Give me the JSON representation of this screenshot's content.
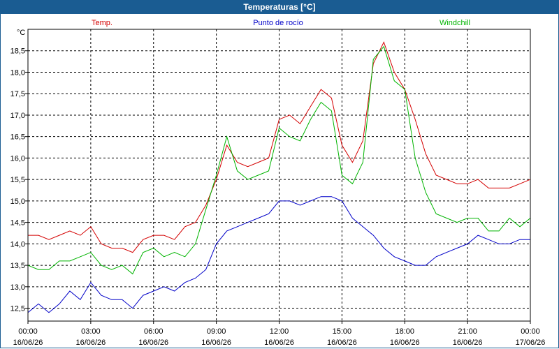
{
  "window": {
    "title": "Temperaturas [°C]"
  },
  "colors": {
    "titlebar": "#1a5c92"
  },
  "chart_data": {
    "type": "line",
    "ylabel": "°C",
    "ylim": [
      12.2,
      19.0
    ],
    "yticks": [
      "12,5",
      "13,0",
      "13,5",
      "14,0",
      "14,5",
      "15,0",
      "15,5",
      "16,0",
      "16,5",
      "17,0",
      "17,5",
      "18,0",
      "18,5"
    ],
    "ytick_values": [
      12.5,
      13.0,
      13.5,
      14.0,
      14.5,
      15.0,
      15.5,
      16.0,
      16.5,
      17.0,
      17.5,
      18.0,
      18.5
    ],
    "xticks": [
      {
        "time": "00:00",
        "date": "16/06/26"
      },
      {
        "time": "03:00",
        "date": "16/06/26"
      },
      {
        "time": "06:00",
        "date": "16/06/26"
      },
      {
        "time": "09:00",
        "date": "16/06/26"
      },
      {
        "time": "12:00",
        "date": "16/06/26"
      },
      {
        "time": "15:00",
        "date": "16/06/26"
      },
      {
        "time": "18:00",
        "date": "16/06/26"
      },
      {
        "time": "21:00",
        "date": "16/06/26"
      },
      {
        "time": "00:00",
        "date": "17/06/26"
      }
    ],
    "xlim_hours": [
      0,
      24
    ],
    "grid": true,
    "series": [
      {
        "name": "Temp.",
        "color": "#d40000",
        "x": [
          0,
          0.5,
          1,
          1.5,
          2,
          2.5,
          3,
          3.5,
          4,
          4.5,
          5,
          5.5,
          6,
          6.5,
          7,
          7.5,
          8,
          8.5,
          9,
          9.5,
          10,
          10.5,
          11,
          11.5,
          12,
          12.5,
          13,
          13.5,
          14,
          14.5,
          15,
          15.5,
          16,
          16.5,
          17,
          17.5,
          18,
          18.5,
          19,
          19.5,
          20,
          20.5,
          21,
          21.5,
          22,
          22.5,
          23,
          23.5,
          24
        ],
        "y": [
          14.2,
          14.2,
          14.1,
          14.2,
          14.3,
          14.2,
          14.4,
          14.0,
          13.9,
          13.9,
          13.8,
          14.1,
          14.2,
          14.2,
          14.1,
          14.4,
          14.5,
          14.9,
          15.5,
          16.3,
          15.9,
          15.8,
          15.9,
          16.0,
          16.9,
          17.0,
          16.8,
          17.2,
          17.6,
          17.4,
          16.3,
          15.9,
          16.4,
          18.2,
          18.7,
          18.0,
          17.6,
          16.9,
          16.1,
          15.6,
          15.5,
          15.4,
          15.4,
          15.5,
          15.3,
          15.3,
          15.3,
          15.4,
          15.5
        ]
      },
      {
        "name": "Punto de rocío",
        "color": "#0000c8",
        "x": [
          0,
          0.5,
          1,
          1.5,
          2,
          2.5,
          3,
          3.5,
          4,
          4.5,
          5,
          5.5,
          6,
          6.5,
          7,
          7.5,
          8,
          8.5,
          9,
          9.5,
          10,
          10.5,
          11,
          11.5,
          12,
          12.5,
          13,
          13.5,
          14,
          14.5,
          15,
          15.5,
          16,
          16.5,
          17,
          17.5,
          18,
          18.5,
          19,
          19.5,
          20,
          20.5,
          21,
          21.5,
          22,
          22.5,
          23,
          23.5,
          24
        ],
        "y": [
          12.4,
          12.6,
          12.4,
          12.6,
          12.9,
          12.7,
          13.1,
          12.8,
          12.7,
          12.7,
          12.5,
          12.8,
          12.9,
          13.0,
          12.9,
          13.1,
          13.2,
          13.4,
          14.0,
          14.3,
          14.4,
          14.5,
          14.6,
          14.7,
          15.0,
          15.0,
          14.9,
          15.0,
          15.1,
          15.1,
          15.0,
          14.6,
          14.4,
          14.2,
          13.9,
          13.7,
          13.6,
          13.5,
          13.5,
          13.7,
          13.8,
          13.9,
          14.0,
          14.2,
          14.1,
          14.0,
          14.0,
          14.1,
          14.1
        ]
      },
      {
        "name": "Windchill",
        "color": "#00b400",
        "x": [
          0,
          0.5,
          1,
          1.5,
          2,
          2.5,
          3,
          3.5,
          4,
          4.5,
          5,
          5.5,
          6,
          6.5,
          7,
          7.5,
          8,
          8.5,
          9,
          9.5,
          10,
          10.5,
          11,
          11.5,
          12,
          12.5,
          13,
          13.5,
          14,
          14.5,
          15,
          15.5,
          16,
          16.5,
          17,
          17.5,
          18,
          18.5,
          19,
          19.5,
          20,
          20.5,
          21,
          21.5,
          22,
          22.5,
          23,
          23.5,
          24
        ],
        "y": [
          13.5,
          13.4,
          13.4,
          13.6,
          13.6,
          13.7,
          13.8,
          13.5,
          13.4,
          13.5,
          13.3,
          13.8,
          13.9,
          13.7,
          13.8,
          13.7,
          14.0,
          14.8,
          15.6,
          16.5,
          15.7,
          15.5,
          15.6,
          15.7,
          16.7,
          16.5,
          16.4,
          16.9,
          17.3,
          17.1,
          15.6,
          15.4,
          15.9,
          18.3,
          18.6,
          17.8,
          17.6,
          16.0,
          15.2,
          14.7,
          14.6,
          14.5,
          14.6,
          14.6,
          14.3,
          14.3,
          14.6,
          14.4,
          14.6
        ]
      }
    ]
  }
}
